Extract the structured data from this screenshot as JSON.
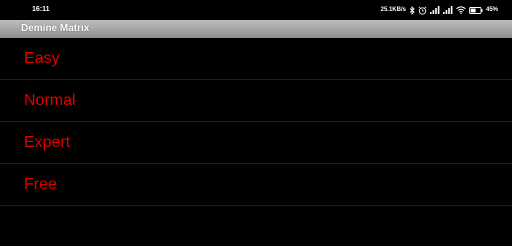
{
  "status_bar": {
    "time": "16:11",
    "network_speed": "25.1KB/s",
    "battery_percent": "45%",
    "icons": [
      "bluetooth-icon",
      "alarm-icon",
      "signal-icon",
      "signal-icon",
      "wifi-icon",
      "battery-icon"
    ]
  },
  "app": {
    "title": "Demine Matrix"
  },
  "menu": {
    "items": [
      {
        "label": "Easy"
      },
      {
        "label": "Normal"
      },
      {
        "label": "Expert"
      },
      {
        "label": "Free"
      }
    ]
  },
  "colors": {
    "background": "#000000",
    "menu_text": "#e00000",
    "title_bar": "#a6a6a6",
    "divider": "#1e1e1e"
  }
}
